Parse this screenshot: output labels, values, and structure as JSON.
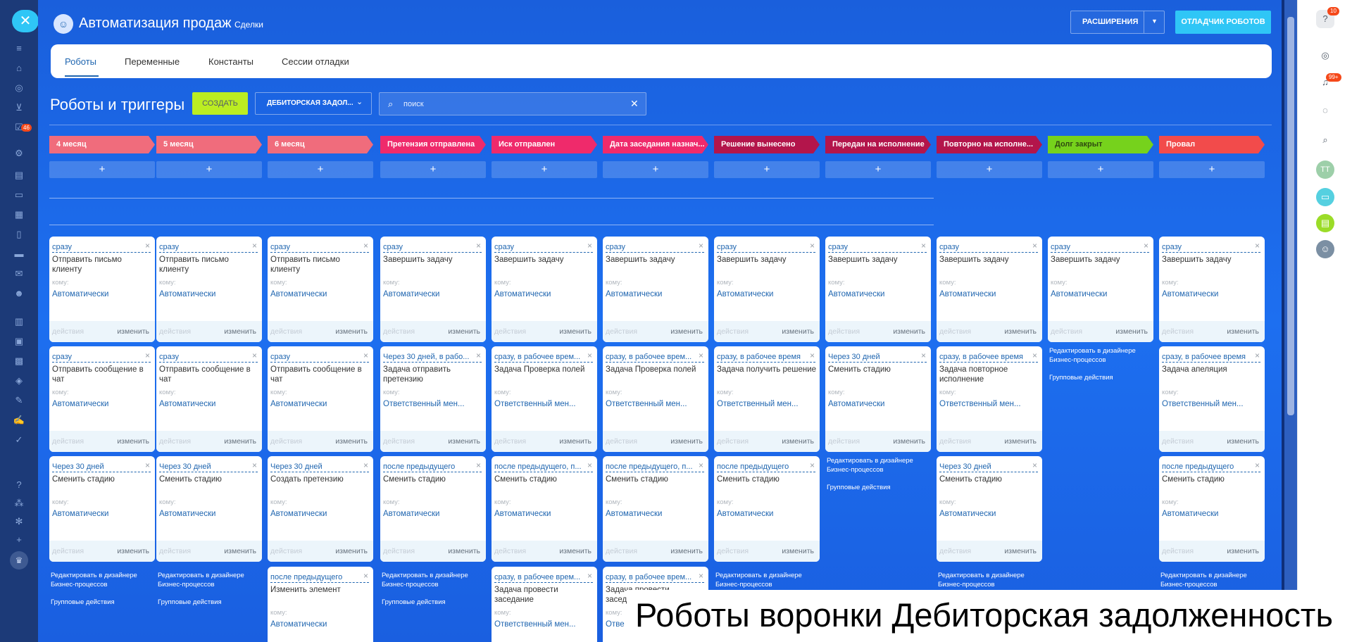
{
  "header": {
    "title": "Автоматизация продаж",
    "subtitle": "Сделки",
    "extensions_button": "РАСШИРЕНИЯ",
    "debug_button": "ОТЛАДЧИК РОБОТОВ"
  },
  "leftbar": {
    "close": "✕",
    "badge": "46"
  },
  "rightbar": {
    "help_badge": "10",
    "notify_badge": "99+",
    "avatar_initials": "ТТ"
  },
  "tabs": [
    {
      "label": "Роботы"
    },
    {
      "label": "Переменные"
    },
    {
      "label": "Константы"
    },
    {
      "label": "Сессии отладки"
    }
  ],
  "section": {
    "title": "Роботы и триггеры",
    "create_button": "СОЗДАТЬ",
    "funnel_label": "ДЕБИТОРСКАЯ ЗАДОЛ...",
    "search_placeholder": "поиск"
  },
  "stages": [
    {
      "name": "4 месяц",
      "color": "#f06c7c"
    },
    {
      "name": "5 месяц",
      "color": "#f06c7c"
    },
    {
      "name": "6 месяц",
      "color": "#f06c7c"
    },
    {
      "name": "Претензия отправлена",
      "color": "#ef2a6b"
    },
    {
      "name": "Иск отправлен",
      "color": "#ef2a6b"
    },
    {
      "name": "Дата заседания назнач...",
      "color": "#ef2a6b"
    },
    {
      "name": "Решение вынесено",
      "color": "#b3154b"
    },
    {
      "name": "Передан на исполнение",
      "color": "#b3154b"
    },
    {
      "name": "Повторно на исполне...",
      "color": "#b3154b"
    },
    {
      "name": "Долг закрыт",
      "color": "#76d21c"
    },
    {
      "name": "Провал",
      "color": "#f24b4b"
    }
  ],
  "card_labels": {
    "whom": "кому:",
    "actions": "действия",
    "edit": "изменить",
    "plus": "+",
    "designer_1": "Редактировать в дизайнере",
    "designer_2": "Бизнес-процессов",
    "group_actions": "Групповые действия"
  },
  "columns": [
    {
      "cards": [
        {
          "cond": "сразу",
          "name": "Отправить письмо клиенту",
          "resp": "Автоматически"
        },
        {
          "cond": "сразу",
          "name": "Отправить сообщение в чат",
          "resp": "Автоматически"
        },
        {
          "cond": "Через 30 дней",
          "name": "Сменить стадию",
          "resp": "Автоматически"
        }
      ]
    },
    {
      "cards": [
        {
          "cond": "сразу",
          "name": "Отправить письмо клиенту",
          "resp": "Автоматически"
        },
        {
          "cond": "сразу",
          "name": "Отправить сообщение в чат",
          "resp": "Автоматически"
        },
        {
          "cond": "Через 30 дней",
          "name": "Сменить стадию",
          "resp": "Автоматически"
        }
      ]
    },
    {
      "cards": [
        {
          "cond": "сразу",
          "name": "Отправить письмо клиенту",
          "resp": "Автоматически"
        },
        {
          "cond": "сразу",
          "name": "Отправить сообщение в чат",
          "resp": "Автоматически"
        },
        {
          "cond": "Через 30 дней",
          "name": "Создать претензию",
          "resp": "Автоматически"
        },
        {
          "cond": "после предыдущего",
          "name": "Изменить элемент",
          "resp": "Автоматически"
        }
      ]
    },
    {
      "cards": [
        {
          "cond": "сразу",
          "name": "Завершить задачу",
          "resp": "Автоматически"
        },
        {
          "cond": "Через 30 дней, в рабо...",
          "name": "Задача отправить претензию",
          "resp": "Ответственный мен..."
        },
        {
          "cond": "после предыдущего",
          "name": "Сменить стадию",
          "resp": "Автоматически"
        }
      ]
    },
    {
      "cards": [
        {
          "cond": "сразу",
          "name": "Завершить задачу",
          "resp": "Автоматически"
        },
        {
          "cond": "сразу, в рабочее врем...",
          "name": "Задача Проверка полей",
          "resp": "Ответственный мен..."
        },
        {
          "cond": "после предыдущего, п...",
          "name": "Сменить стадию",
          "resp": "Автоматически"
        },
        {
          "cond": "сразу, в рабочее врем...",
          "name": "Задача провести заседание",
          "resp": "Ответственный мен..."
        }
      ]
    },
    {
      "cards": [
        {
          "cond": "сразу",
          "name": "Завершить задачу",
          "resp": "Автоматически"
        },
        {
          "cond": "сразу, в рабочее врем...",
          "name": "Задача Проверка полей",
          "resp": "Ответственный мен..."
        },
        {
          "cond": "после предыдущего, п...",
          "name": "Сменить стадию",
          "resp": "Автоматически"
        },
        {
          "cond": "сразу, в рабочее врем...",
          "name": "Задача провести заседание",
          "resp": "Отве"
        }
      ]
    },
    {
      "cards": [
        {
          "cond": "сразу",
          "name": "Завершить задачу",
          "resp": "Автоматически"
        },
        {
          "cond": "сразу, в рабочее время",
          "name": "Задача получить решение",
          "resp": "Ответственный мен..."
        },
        {
          "cond": "после предыдущего",
          "name": "Сменить стадию",
          "resp": "Автоматически"
        }
      ]
    },
    {
      "cards": [
        {
          "cond": "сразу",
          "name": "Завершить задачу",
          "resp": "Автоматически"
        },
        {
          "cond": "Через 30 дней",
          "name": "Сменить стадию",
          "resp": "Автоматически"
        }
      ]
    },
    {
      "cards": [
        {
          "cond": "сразу",
          "name": "Завершить задачу",
          "resp": "Автоматически"
        },
        {
          "cond": "сразу, в рабочее время",
          "name": "Задача повторное исполнение",
          "resp": "Ответственный мен..."
        },
        {
          "cond": "Через 30 дней",
          "name": "Сменить стадию",
          "resp": "Автоматически"
        }
      ]
    },
    {
      "cards": [
        {
          "cond": "сразу",
          "name": "Завершить задачу",
          "resp": "Автоматически"
        }
      ]
    },
    {
      "cards": [
        {
          "cond": "сразу",
          "name": "Завершить задачу",
          "resp": "Автоматически"
        },
        {
          "cond": "сразу, в рабочее время",
          "name": "Задача апеляция",
          "resp": "Ответственный мен..."
        },
        {
          "cond": "после предыдущего",
          "name": "Сменить стадию",
          "resp": "Автоматически"
        }
      ]
    }
  ],
  "caption": "Роботы воронки Дебиторская задолженность"
}
